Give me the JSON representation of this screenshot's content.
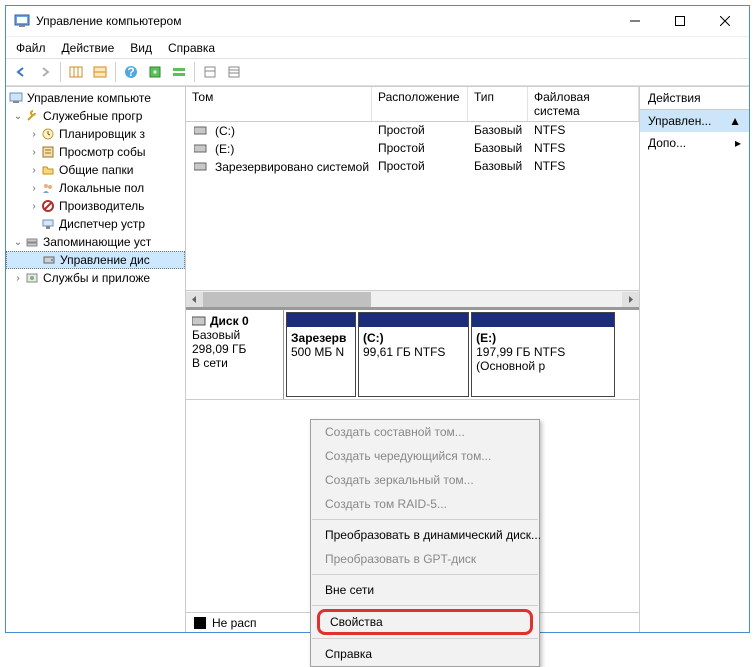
{
  "titlebar": {
    "title": "Управление компьютером"
  },
  "menu": {
    "file": "Файл",
    "action": "Действие",
    "view": "Вид",
    "help": "Справка"
  },
  "tree": {
    "root": "Управление компьюте",
    "sys": "Служебные прогр",
    "sched": "Планировщик з",
    "event": "Просмотр собы",
    "shared": "Общие папки",
    "users": "Локальные пол",
    "perf": "Производитель",
    "devmgr": "Диспетчер устр",
    "storage": "Запоминающие уст",
    "diskmgmt": "Управление дис",
    "services": "Службы и приложе"
  },
  "columns": {
    "vol": "Том",
    "layout": "Расположение",
    "type": "Тип",
    "fs": "Файловая система"
  },
  "volumes": [
    {
      "name": "(C:)",
      "layout": "Простой",
      "type": "Базовый",
      "fs": "NTFS"
    },
    {
      "name": "(E:)",
      "layout": "Простой",
      "type": "Базовый",
      "fs": "NTFS"
    },
    {
      "name": "Зарезервировано системой",
      "layout": "Простой",
      "type": "Базовый",
      "fs": "NTFS"
    }
  ],
  "disk0": {
    "icon_label": "Диск 0",
    "type": "Базовый",
    "size": "298,09 ГБ",
    "status": "В сети",
    "parts": [
      {
        "name": "Зарезерв",
        "detail": "500 МБ N"
      },
      {
        "name": "(C:)",
        "detail": "99,61 ГБ NTFS"
      },
      {
        "name": "(E:)",
        "detail": "197,99 ГБ NTFS",
        "extra": "(Основной р"
      }
    ]
  },
  "legend": {
    "unalloc": "Не расп"
  },
  "actions": {
    "header": "Действия",
    "manage": "Управлен...",
    "more": "Допо..."
  },
  "ctx": {
    "spanned": "Создать составной том...",
    "striped": "Создать чередующийся том...",
    "mirrored": "Создать зеркальный том...",
    "raid5": "Создать том RAID-5...",
    "todyn": "Преобразовать в динамический диск...",
    "togpt": "Преобразовать в GPT-диск",
    "offline": "Вне сети",
    "props": "Свойства",
    "help": "Справка"
  }
}
